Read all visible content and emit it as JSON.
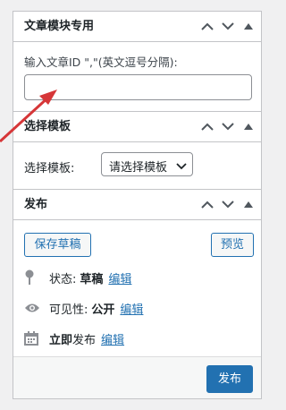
{
  "article_module": {
    "title": "文章模块专用",
    "id_label": "输入文章ID \",\"(英文逗号分隔):",
    "id_value": ""
  },
  "template": {
    "title": "选择模板",
    "label": "选择模板:",
    "selected": "请选择模板"
  },
  "publish": {
    "title": "发布",
    "save_draft": "保存草稿",
    "preview": "预览",
    "status_label": "状态:",
    "status_value": "草稿",
    "visibility_label": "可见性:",
    "visibility_value": "公开",
    "date_bold": "立即",
    "date_label": "发布",
    "edit": "编辑",
    "publish_button": "发布"
  },
  "colors": {
    "accent": "#2271b1",
    "annotation_arrow": "#d63638"
  },
  "icons": [
    "chevron-up-icon",
    "chevron-down-icon",
    "triangle-up-icon",
    "pin-icon",
    "eye-icon",
    "calendar-icon",
    "select-arrow-icon"
  ]
}
